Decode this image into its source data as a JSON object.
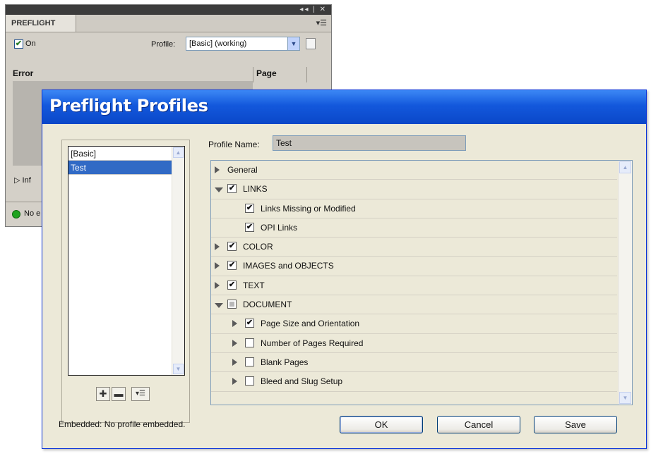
{
  "panel": {
    "title": "PREFLIGHT",
    "menu_icon": "panel-menu-icon",
    "on_label": "On",
    "on_checked": true,
    "profile_label": "Profile:",
    "profile_value": "[Basic] (working)",
    "col_error": "Error",
    "col_page": "Page",
    "info_label": "Inf",
    "status_text": "No e",
    "topbar_controls": "◂◂ | ✕"
  },
  "dialog": {
    "title": "Preflight Profiles",
    "profiles": [
      "[Basic]",
      "Test"
    ],
    "selected_profile": "Test",
    "profile_name_label": "Profile Name:",
    "profile_name_value": "Test",
    "tree": [
      {
        "label": "General",
        "expander": "collapsed",
        "checkbox": "none",
        "indent": 0
      },
      {
        "label": "LINKS",
        "expander": "expanded",
        "checkbox": "checked",
        "indent": 0
      },
      {
        "label": "Links Missing or Modified",
        "expander": "none",
        "checkbox": "checked",
        "indent": 1
      },
      {
        "label": "OPI Links",
        "expander": "none",
        "checkbox": "checked",
        "indent": 1
      },
      {
        "label": "COLOR",
        "expander": "collapsed",
        "checkbox": "checked",
        "indent": 0
      },
      {
        "label": "IMAGES and OBJECTS",
        "expander": "collapsed",
        "checkbox": "checked",
        "indent": 0
      },
      {
        "label": "TEXT",
        "expander": "collapsed",
        "checkbox": "checked",
        "indent": 0
      },
      {
        "label": "DOCUMENT",
        "expander": "expanded",
        "checkbox": "partial",
        "indent": 0
      },
      {
        "label": "Page Size and Orientation",
        "expander": "collapsed",
        "checkbox": "checked",
        "indent": 1
      },
      {
        "label": "Number of Pages Required",
        "expander": "collapsed",
        "checkbox": "unchecked",
        "indent": 1
      },
      {
        "label": "Blank Pages",
        "expander": "collapsed",
        "checkbox": "unchecked",
        "indent": 1
      },
      {
        "label": "Bleed and Slug Setup",
        "expander": "collapsed",
        "checkbox": "unchecked",
        "indent": 1
      }
    ],
    "embedded_text": "Embedded: No profile embedded.",
    "ok_label": "OK",
    "cancel_label": "Cancel",
    "save_label": "Save",
    "tool_buttons": [
      "new-profile-icon",
      "delete-profile-icon",
      "profile-menu-icon"
    ],
    "colors": {
      "title_bar": "#1358dc",
      "selection": "#316ac5",
      "dialog_bg": "#ece9d8"
    }
  }
}
